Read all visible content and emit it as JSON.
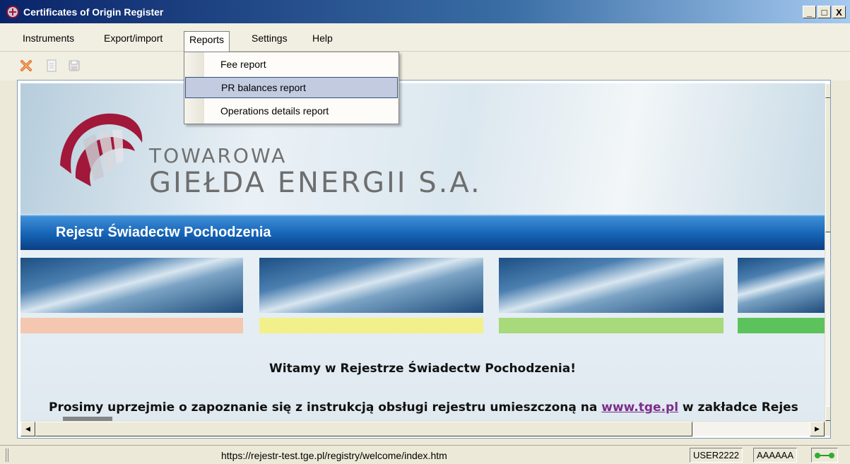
{
  "window": {
    "title": "Certificates of Origin Register",
    "controls": [
      "_",
      "□",
      "X"
    ]
  },
  "menubar": {
    "items": [
      "Instruments",
      "Export/import",
      "Reports",
      "Settings",
      "Help"
    ],
    "open_menu": "Reports"
  },
  "reports_menu": {
    "items": [
      "Fee report",
      "PR balances report",
      "Operations details report"
    ],
    "highlighted": "PR balances report"
  },
  "toolbar": {
    "icons": [
      "close-x-icon",
      "document-icon",
      "save-icon"
    ]
  },
  "page": {
    "logo_line1": "TOWAROWA",
    "logo_line2": "GIEŁDA ENERGII S.A.",
    "band_title": "Rejestr Świadectw Pochodzenia",
    "stripe_colors": [
      "#f4c7b0",
      "#f2f08a",
      "#a8d97a",
      "#5cc35c"
    ],
    "welcome": "Witamy w Rejestrze Świadectw Pochodzenia!",
    "instruction_before": "Prosimy uprzejmie o zapoznanie się z instrukcją obsługi rejestru umieszczoną na ",
    "instruction_link": "www.tge.pl",
    "instruction_after": " w zakładce Rejes"
  },
  "statusbar": {
    "url": "https://rejestr-test.tge.pl/registry/welcome/index.htm",
    "user": "USER2222",
    "code": "AAAAAA"
  }
}
